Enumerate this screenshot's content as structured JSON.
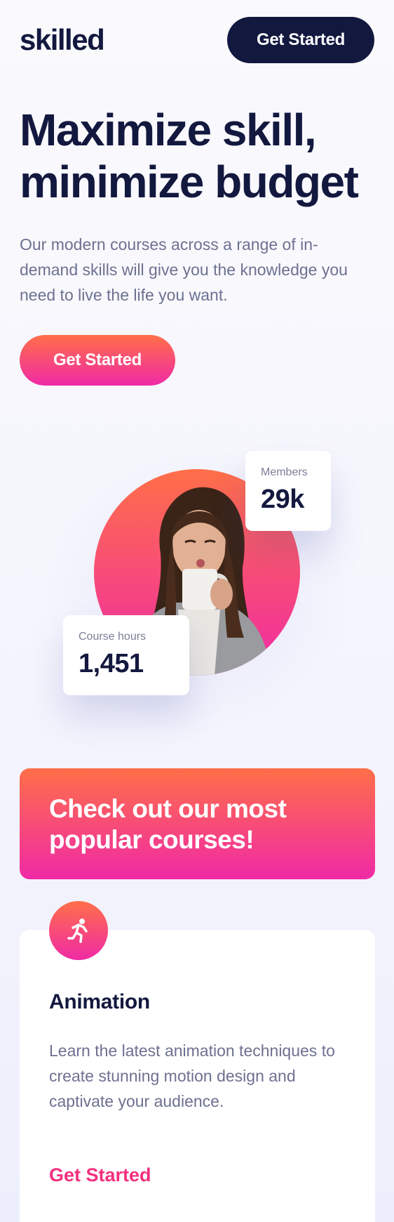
{
  "header": {
    "logo": "skilled",
    "cta_label": "Get Started"
  },
  "hero": {
    "title": "Maximize skill, minimize budget",
    "description": "Our modern courses across a range of in-demand skills will give you the knowledge you need to live the life you want.",
    "cta_label": "Get Started"
  },
  "stats": {
    "members": {
      "label": "Members",
      "value": "29k"
    },
    "course_hours": {
      "label": "Course hours",
      "value": "1,451"
    }
  },
  "popular": {
    "heading": "Check out our most popular courses!"
  },
  "courses": [
    {
      "icon": "running-person-icon",
      "title": "Animation",
      "description": "Learn the latest animation techniques to create stunning motion design and captivate your audience.",
      "link_label": "Get Started"
    }
  ],
  "colors": {
    "navy": "#13183f",
    "gradient_top": "#ff6f48",
    "gradient_bottom": "#f02aa6",
    "link_pink": "#f3307f"
  }
}
